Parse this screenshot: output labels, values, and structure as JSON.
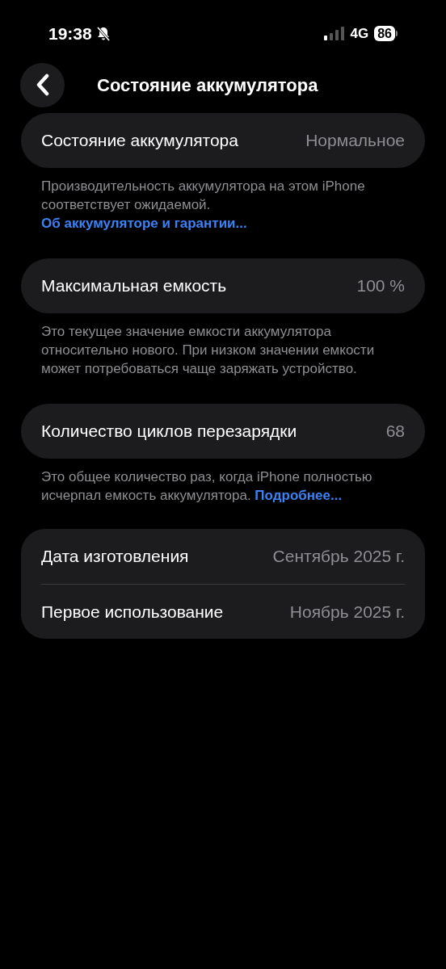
{
  "status_bar": {
    "time": "19:38",
    "network": "4G",
    "battery": "86"
  },
  "nav": {
    "title": "Состояние аккумулятора"
  },
  "sections": [
    {
      "rows": [
        {
          "label": "Состояние аккумулятора",
          "value": "Нормальное"
        }
      ],
      "footer": {
        "text": "Производительность аккумулятора на этом iPhone соответствует ожидаемой.",
        "link": "Об аккумуляторе и гарантии..."
      }
    },
    {
      "rows": [
        {
          "label": "Максимальная емкость",
          "value": "100 %"
        }
      ],
      "footer": {
        "text": "Это текущее значение емкости аккумулятора относительно нового. При низком значении емкости может потребоваться чаще заряжать устройство."
      }
    },
    {
      "rows": [
        {
          "label": "Количество циклов перезарядки",
          "value": "68"
        }
      ],
      "footer": {
        "text": "Это общее количество раз, когда iPhone полностью исчерпал емкость аккумулятора.",
        "link": "Подробнее..."
      }
    },
    {
      "rows": [
        {
          "label": "Дата изготовления",
          "value": "Сентябрь 2025 г."
        },
        {
          "label": "Первое использование",
          "value": "Ноябрь 2025 г."
        }
      ]
    }
  ]
}
